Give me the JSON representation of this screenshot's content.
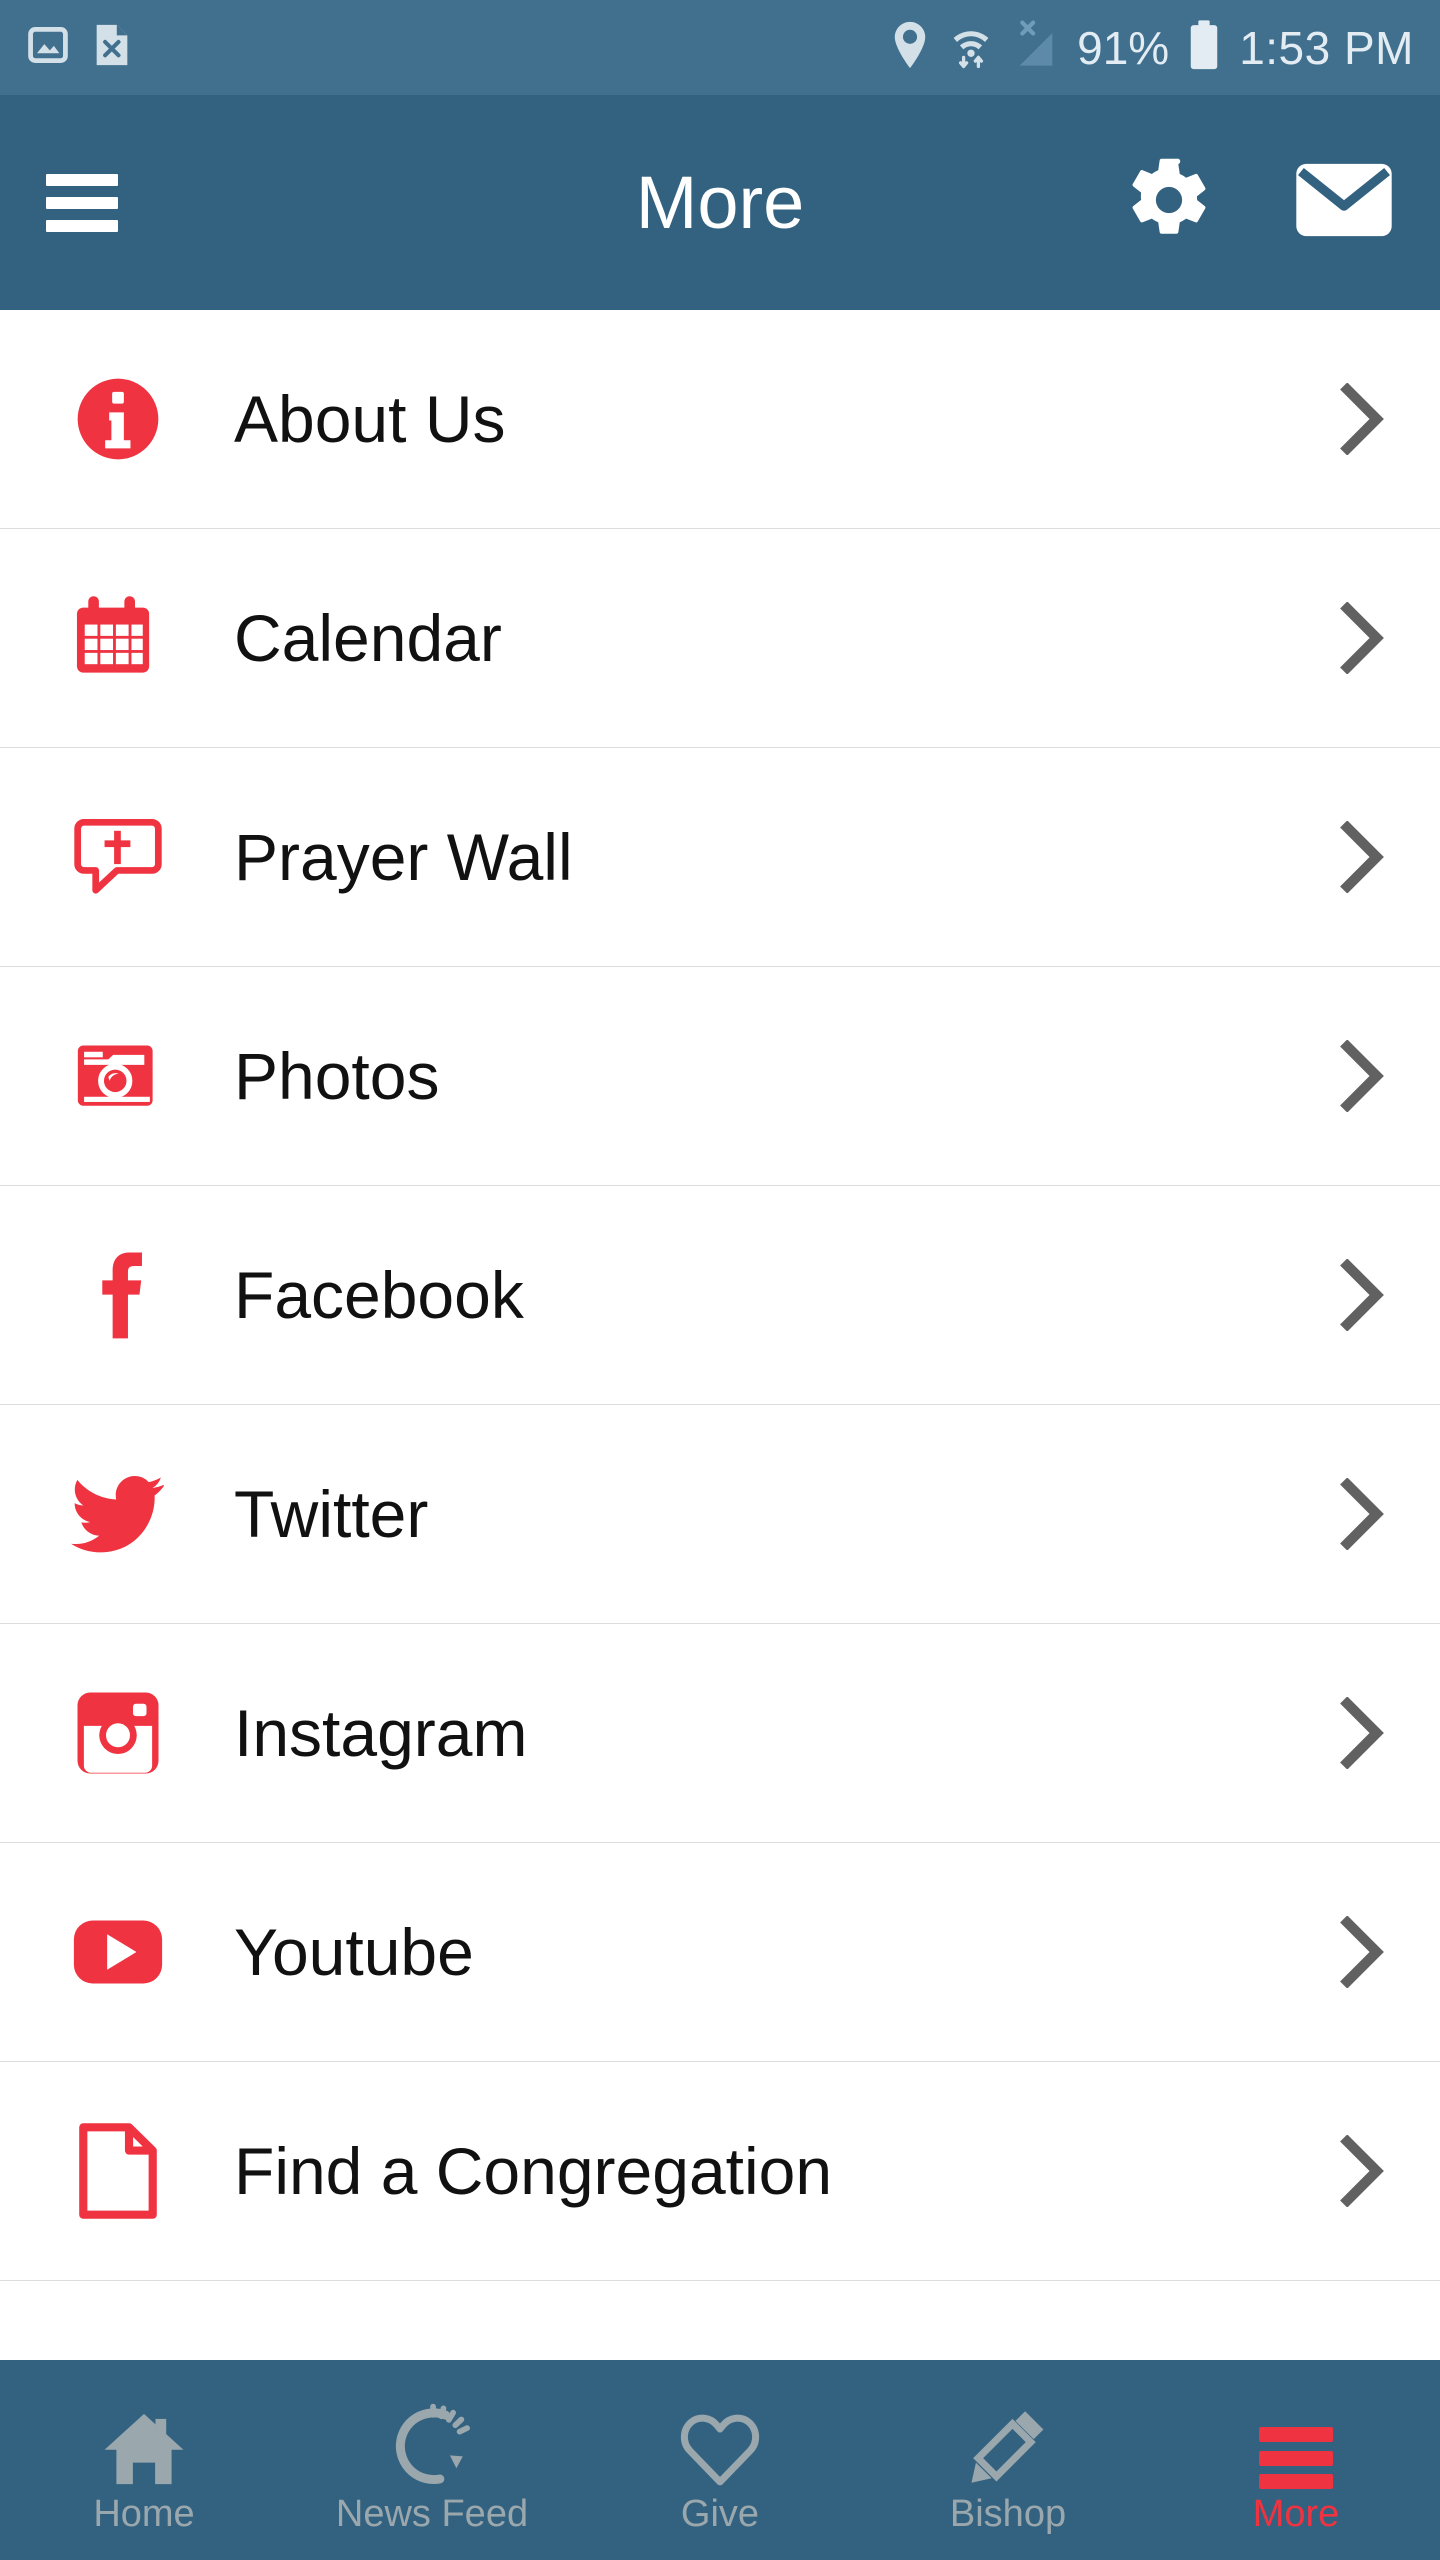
{
  "status_bar": {
    "icons_left": [
      "image-icon",
      "file-x-icon"
    ],
    "icons_right": [
      "location-pin-icon",
      "wifi-icon",
      "signal-no-service-icon",
      "battery-icon"
    ],
    "battery_percent": "91%",
    "time": "1:53 PM",
    "background_color": "#41708f",
    "foreground_color": "#e2ecf2"
  },
  "header": {
    "title": "More",
    "menu_icon": "hamburger-icon",
    "settings_icon": "gear-icon",
    "mail_icon": "envelope-icon",
    "background_color": "#336280"
  },
  "menu": {
    "accent_color": "#ef3340",
    "chevron_icon": "chevron-right-icon",
    "items": [
      {
        "label": "About Us",
        "icon": "info-circle-icon"
      },
      {
        "label": "Calendar",
        "icon": "calendar-icon"
      },
      {
        "label": "Prayer Wall",
        "icon": "speech-bubble-cross-icon"
      },
      {
        "label": "Photos",
        "icon": "camera-icon"
      },
      {
        "label": "Facebook",
        "icon": "facebook-icon"
      },
      {
        "label": "Twitter",
        "icon": "twitter-icon"
      },
      {
        "label": "Instagram",
        "icon": "instagram-icon"
      },
      {
        "label": "Youtube",
        "icon": "youtube-icon"
      },
      {
        "label": "Find a Congregation",
        "icon": "document-icon"
      }
    ]
  },
  "bottom_nav": {
    "active_color": "#ef3340",
    "inactive_color": "#9aa7ad",
    "items": [
      {
        "label": "Home",
        "icon": "home-icon",
        "active": false
      },
      {
        "label": "News Feed",
        "icon": "refresh-icon",
        "active": false
      },
      {
        "label": "Give",
        "icon": "heart-icon",
        "active": false
      },
      {
        "label": "Bishop",
        "icon": "pencil-icon",
        "active": false
      },
      {
        "label": "More",
        "icon": "hamburger-icon",
        "active": true
      }
    ]
  }
}
